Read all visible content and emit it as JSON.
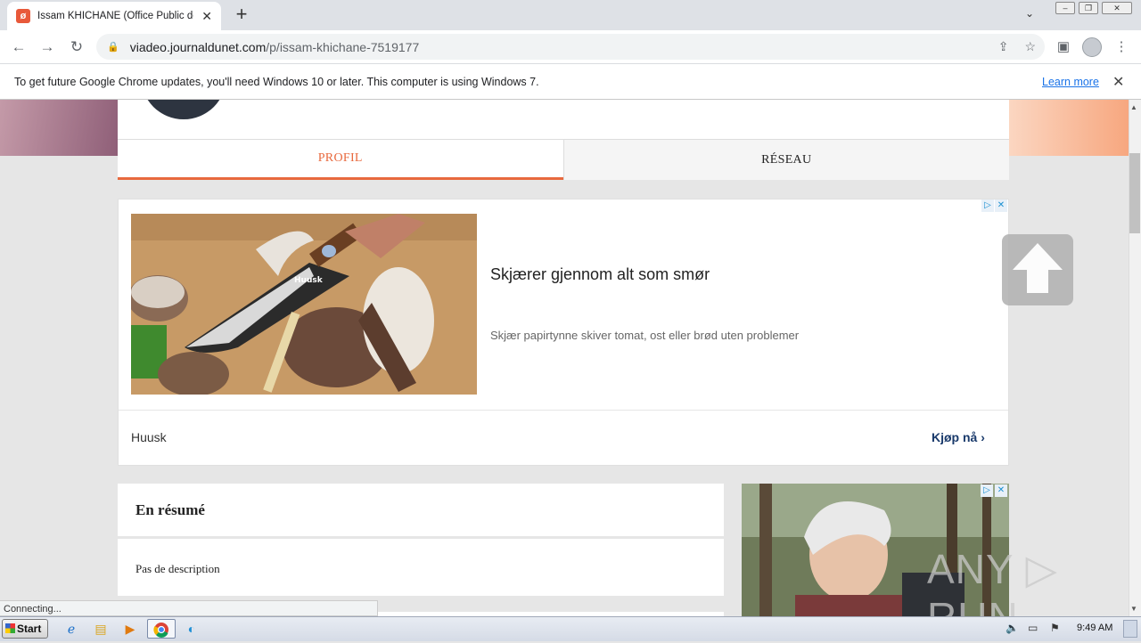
{
  "browser": {
    "tab_title": "Issam KHICHANE (Office Public de T",
    "tab_favicon": "ø",
    "tab_close": "✕",
    "new_tab": "+",
    "url_host": "viadeo.journaldunet.com",
    "url_path": "/p/issam-khichane-7519177",
    "back_icon": "←",
    "forward_icon": "→",
    "reload_icon": "↻",
    "menu_icon": "⋮"
  },
  "infobar": {
    "message": "To get future Google Chrome updates, you'll need Windows 10 or later. This computer is using Windows 7.",
    "learn_more": "Learn more",
    "close": "✕"
  },
  "profile": {
    "tabs": [
      {
        "label": "PROFIL"
      },
      {
        "label": "RÉSEAU"
      }
    ]
  },
  "ad": {
    "headline": "Skjærer gjennom alt som smør",
    "body": "Skjær papirtynne skiver tomat, ost eller brød uten problemer",
    "brand": "Huusk",
    "cta": "Kjøp nå ›",
    "image_label": "Huusk"
  },
  "summary": {
    "title": "En résumé",
    "description": "Pas de description"
  },
  "status_text": "Connecting...",
  "watermark": "ANY ▷ RUN",
  "taskbar": {
    "start": "Start",
    "clock": "9:49 AM"
  },
  "colors": {
    "accent": "#e8693e",
    "link": "#1a73e8"
  }
}
